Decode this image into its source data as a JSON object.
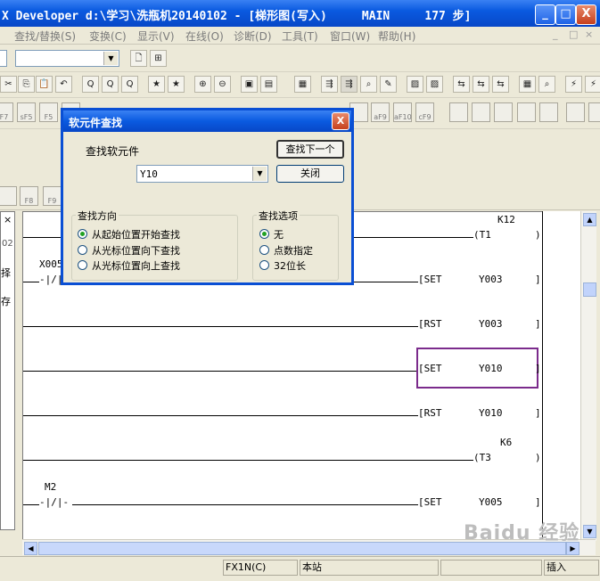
{
  "window": {
    "title": "X Developer d:\\学习\\洗瓶机20140102 - [梯形图(写入)     MAIN     177 步]",
    "buttons": {
      "minimize": "_",
      "maximize": "□",
      "close": "X"
    }
  },
  "menubar": {
    "items": [
      "查找/替换(S)",
      "变换(C)",
      "显示(V)",
      "在线(O)",
      "诊断(D)",
      "工具(T)",
      "窗口(W)",
      "帮助(H)"
    ],
    "mdi_buttons": [
      "_",
      "□",
      "×"
    ]
  },
  "toolbar": {
    "combo_value": "",
    "fkeys": [
      "F7",
      "sF5",
      "F5",
      "aF8",
      "aF9",
      "aF10",
      "cF9",
      "F8",
      "F9"
    ]
  },
  "dialog": {
    "title": "软元件查找",
    "close": "X",
    "find_label": "查找软元件",
    "find_value": "Y10",
    "find_next_button": "查找下一个",
    "close_button": "关闭",
    "direction": {
      "title": "查找方向",
      "options": [
        "从起始位置开始查找",
        "从光标位置向下查找",
        "从光标位置向上查找"
      ],
      "selected": 0
    },
    "options": {
      "title": "查找选项",
      "items": [
        "无",
        "点数指定",
        "32位长"
      ],
      "selected": 0
    }
  },
  "left_panel": {
    "tab_close": "×",
    "label_1": "02",
    "label_2": "择",
    "label_3": "存"
  },
  "ladder": {
    "rungs": [
      {
        "contact": "",
        "coil": "(T1",
        "operand": "",
        "setting": "K12"
      },
      {
        "contact": "X005",
        "coil": "[SET",
        "operand": "Y003"
      },
      {
        "contact": "",
        "coil": "[RST",
        "operand": "Y003"
      },
      {
        "contact": "",
        "coil": "[SET",
        "operand": "Y010",
        "highlighted": true
      },
      {
        "contact": "",
        "coil": "[RST",
        "operand": "Y010"
      },
      {
        "contact": "",
        "coil": "(T3",
        "operand": "",
        "setting": "K6"
      },
      {
        "contact": "M2",
        "coil": "[SET",
        "operand": "Y005"
      }
    ]
  },
  "statusbar": {
    "plc": "FX1N(C)",
    "station": "本站",
    "mode": "插入"
  },
  "watermark": "Baidu 经验",
  "colors": {
    "titlebar": "#0a5ae0",
    "highlight": "#7b2b8c",
    "face": "#ece9d8"
  }
}
